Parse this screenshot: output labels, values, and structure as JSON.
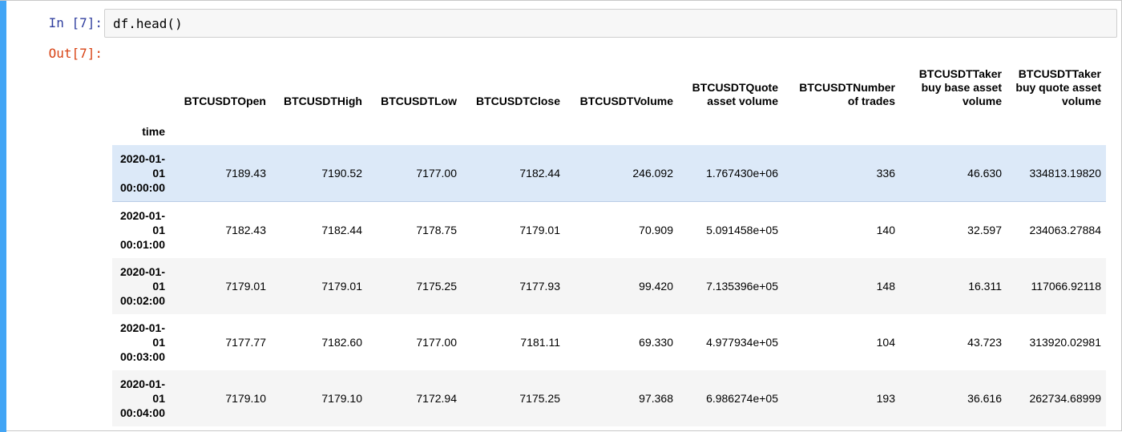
{
  "cell": {
    "in_prompt": "In [7]:",
    "code": "df.head()",
    "out_prompt": "Out[7]:"
  },
  "colors": {
    "cell_bar": "#42a5f5",
    "highlight_row": "#dce9f8",
    "stripe_row": "#f5f5f5"
  },
  "table": {
    "index_name": "time",
    "columns": [
      "BTCUSDTOpen",
      "BTCUSDTHigh",
      "BTCUSDTLow",
      "BTCUSDTClose",
      "BTCUSDTVolume",
      "BTCUSDTQuote asset volume",
      "BTCUSDTNumber of trades",
      "BTCUSDTTaker buy base asset volume",
      "BTCUSDTTaker buy quote asset volume"
    ],
    "rows": [
      {
        "index": "2020-01-01 00:00:00",
        "values": [
          "7189.43",
          "7190.52",
          "7177.00",
          "7182.44",
          "246.092",
          "1.767430e+06",
          "336",
          "46.630",
          "334813.19820"
        ]
      },
      {
        "index": "2020-01-01 00:01:00",
        "values": [
          "7182.43",
          "7182.44",
          "7178.75",
          "7179.01",
          "70.909",
          "5.091458e+05",
          "140",
          "32.597",
          "234063.27884"
        ]
      },
      {
        "index": "2020-01-01 00:02:00",
        "values": [
          "7179.01",
          "7179.01",
          "7175.25",
          "7177.93",
          "99.420",
          "7.135396e+05",
          "148",
          "16.311",
          "117066.92118"
        ]
      },
      {
        "index": "2020-01-01 00:03:00",
        "values": [
          "7177.77",
          "7182.60",
          "7177.00",
          "7181.11",
          "69.330",
          "4.977934e+05",
          "104",
          "43.723",
          "313920.02981"
        ]
      },
      {
        "index": "2020-01-01 00:04:00",
        "values": [
          "7179.10",
          "7179.10",
          "7172.94",
          "7175.25",
          "97.368",
          "6.986274e+05",
          "193",
          "36.616",
          "262734.68999"
        ]
      }
    ]
  }
}
